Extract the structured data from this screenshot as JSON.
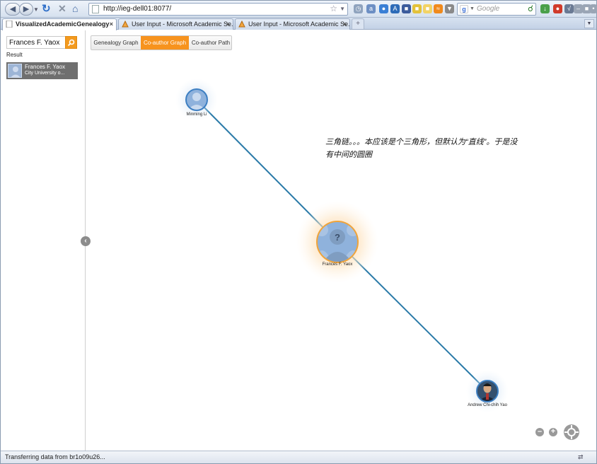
{
  "browser": {
    "url": "http://ieg-dell01:8077/",
    "search_placeholder": "Google",
    "tabs": [
      {
        "title": "VisualizedAcademicGenealogy",
        "active": true
      },
      {
        "title": "User Input - Microsoft Academic Se...",
        "active": false
      },
      {
        "title": "User Input - Microsoft Academic Se...",
        "active": false
      }
    ],
    "status": "Transferring data from br1o09u26..."
  },
  "sidebar": {
    "search_value": "Frances F. Yaox",
    "result_label": "Result",
    "results": [
      {
        "name": "Frances F. Yaox",
        "affiliation": "City University o..."
      }
    ]
  },
  "view_tabs": [
    {
      "label": "Genealogy Graph",
      "active": false
    },
    {
      "label": "Co-author Graph",
      "active": true
    },
    {
      "label": "Co-author Path",
      "active": false
    }
  ],
  "graph": {
    "nodes": [
      {
        "label": "Minming Li"
      },
      {
        "label": "Frances F. Yaox"
      },
      {
        "label": "Andrew Chi-chih Yao"
      }
    ],
    "annotation": "三角链。。。本应该是个三角形，但默认为“直线”。于是没有中间的圆圈"
  },
  "colors": {
    "accent": "#f7931e",
    "edge": "#2a7aa8",
    "node_ring": "#3d7fc2"
  }
}
